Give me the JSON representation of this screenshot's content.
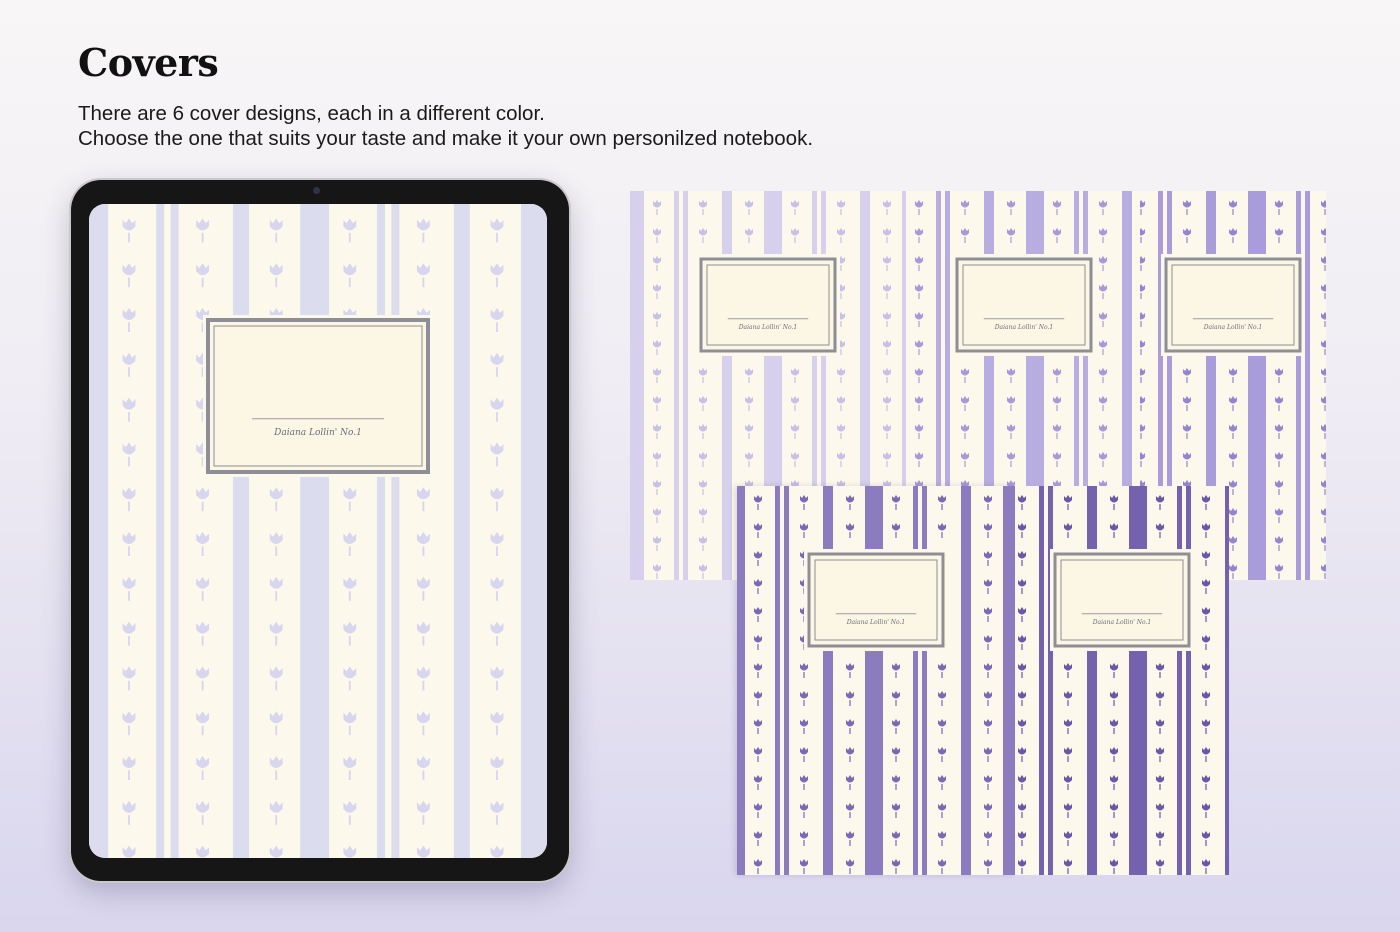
{
  "heading": "Covers",
  "description": {
    "line1": "There are 6 cover designs, each in a different color.",
    "line2": "Choose the one that suits your taste and make it your own personilzed notebook."
  },
  "label_text": "Daiana Lollin' No.1",
  "colors": {
    "cream": "#fdf8ec",
    "cream_label": "#fcf6e4",
    "label_frame": "#8e8e96",
    "tablet_bezel": "#161616"
  },
  "covers": [
    {
      "id": "tablet",
      "accent": "#dcdcef",
      "motif": "#d8d6ee"
    },
    {
      "id": "cover-1",
      "accent": "#d6d0ec",
      "motif": "#c8c0e6"
    },
    {
      "id": "cover-2",
      "accent": "#b8ade0",
      "motif": "#a89ad8"
    },
    {
      "id": "cover-3",
      "accent": "#a99cdb",
      "motif": "#9385d0"
    },
    {
      "id": "cover-4",
      "accent": "#8b7cc0",
      "motif": "#7a6ab5"
    },
    {
      "id": "cover-5",
      "accent": "#7562ae",
      "motif": "#6a58a6"
    }
  ]
}
